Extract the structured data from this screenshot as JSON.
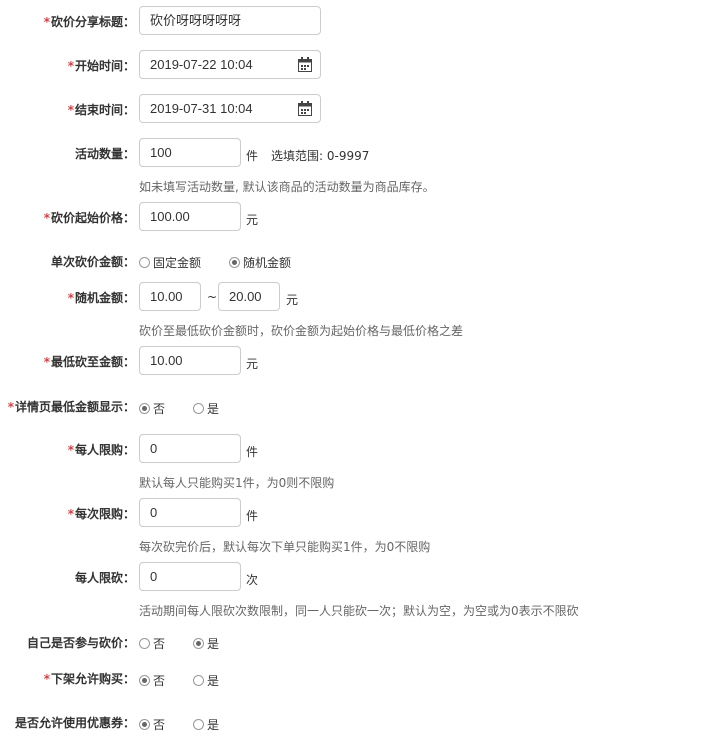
{
  "form": {
    "share_title": {
      "label": "砍价分享标题：",
      "value": "砍价呀呀呀呀呀"
    },
    "start_time": {
      "label": "开始时间：",
      "value": "2019-07-22 10:04",
      "icon": "calendar-icon"
    },
    "end_time": {
      "label": "结束时间：",
      "value": "2019-07-31 10:04",
      "icon": "calendar-icon"
    },
    "quantity": {
      "label": "活动数量：",
      "value": "100",
      "unit": "件",
      "range": "选填范围: 0-9997",
      "help": "如未填写活动数量, 默认该商品的活动数量为商品库存。"
    },
    "start_price": {
      "label": "砍价起始价格：",
      "value": "100.00",
      "unit": "元"
    },
    "cut_amount_type": {
      "label": "单次砍价金额：",
      "options": [
        "固定金额",
        "随机金额"
      ],
      "selected": 1
    },
    "random_amount": {
      "label": "随机金额：",
      "min": "10.00",
      "sep": "~",
      "max": "20.00",
      "unit": "元",
      "help": "砍价至最低砍价金额时，砍价金额为起始价格与最低价格之差"
    },
    "min_price": {
      "label": "最低砍至金额：",
      "value": "10.00",
      "unit": "元"
    },
    "show_min_price": {
      "label": "详情页最低金额显示：",
      "options": [
        "否",
        "是"
      ],
      "selected": 0
    },
    "per_user_limit": {
      "label": "每人限购：",
      "value": "0",
      "unit": "件",
      "help": "默认每人只能购买1件，为0则不限购"
    },
    "per_order_limit": {
      "label": "每次限购：",
      "value": "0",
      "unit": "件",
      "help": "每次砍完价后，默认每次下单只能购买1件，为0不限购"
    },
    "per_user_cut_limit": {
      "label": "每人限砍：",
      "value": "0",
      "unit": "次",
      "help": "活动期间每人限砍次数限制，同一人只能砍一次；默认为空，为空或为0表示不限砍"
    },
    "self_cut": {
      "label": "自己是否参与砍价：",
      "options": [
        "否",
        "是"
      ],
      "selected": 1
    },
    "allow_buy_offshelf": {
      "label": "下架允许购买：",
      "options": [
        "否",
        "是"
      ],
      "selected": 0
    },
    "allow_coupon": {
      "label": "是否允许使用优惠券：",
      "options": [
        "否",
        "是"
      ],
      "selected": 0
    }
  },
  "required_mark": "*",
  "colors": {
    "required": "#e4393c",
    "border": "#cccccc",
    "help_text": "#666666"
  }
}
